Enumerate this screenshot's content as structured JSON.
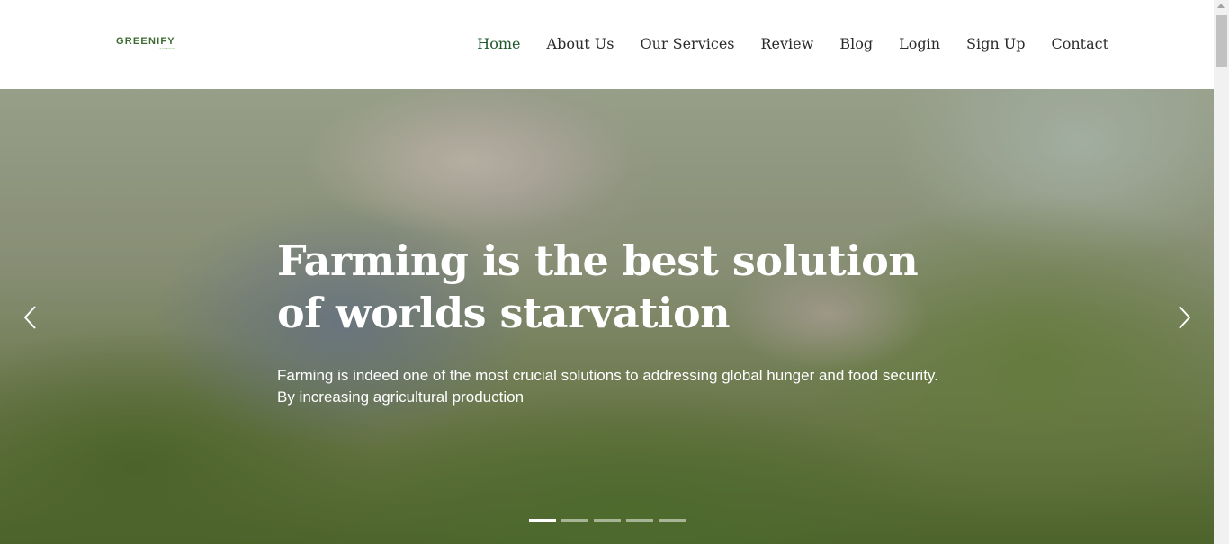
{
  "brand": {
    "logo_text": "GREENIFY",
    "logo_tagline": "FARMING"
  },
  "nav": {
    "items": [
      {
        "label": "Home",
        "active": true
      },
      {
        "label": "About Us"
      },
      {
        "label": "Our Services"
      },
      {
        "label": "Review"
      },
      {
        "label": "Blog"
      },
      {
        "label": "Login"
      },
      {
        "label": "Sign Up"
      },
      {
        "label": "Contact"
      }
    ]
  },
  "hero": {
    "title": "Farming is the best solution of worlds starvation",
    "text_line1": "Farming is indeed one of the most crucial solutions to addressing global hunger and food security.",
    "text_line2": "By increasing agricultural production",
    "prev_icon": "chevron-left-icon",
    "next_icon": "chevron-right-icon",
    "slide_count": 5,
    "active_slide": 1
  },
  "colors": {
    "nav_active": "#1f5a2e",
    "nav_text": "#2b2b2b",
    "brand_green": "#3b6b2f",
    "hero_text": "#ffffff"
  }
}
